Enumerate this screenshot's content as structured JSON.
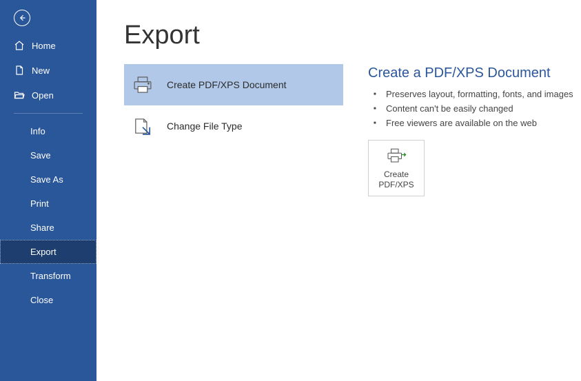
{
  "sidebar": {
    "top": [
      {
        "label": "Home"
      },
      {
        "label": "New"
      },
      {
        "label": "Open"
      }
    ],
    "items": [
      {
        "label": "Info"
      },
      {
        "label": "Save"
      },
      {
        "label": "Save As"
      },
      {
        "label": "Print"
      },
      {
        "label": "Share"
      },
      {
        "label": "Export"
      },
      {
        "label": "Transform"
      },
      {
        "label": "Close"
      }
    ]
  },
  "page": {
    "title": "Export"
  },
  "options": [
    {
      "label": "Create PDF/XPS Document"
    },
    {
      "label": "Change File Type"
    }
  ],
  "details": {
    "heading": "Create a PDF/XPS Document",
    "bullets": [
      "Preserves layout, formatting, fonts, and images",
      "Content can't be easily changed",
      "Free viewers are available on the web"
    ],
    "button": {
      "line1": "Create",
      "line2": "PDF/XPS"
    }
  }
}
